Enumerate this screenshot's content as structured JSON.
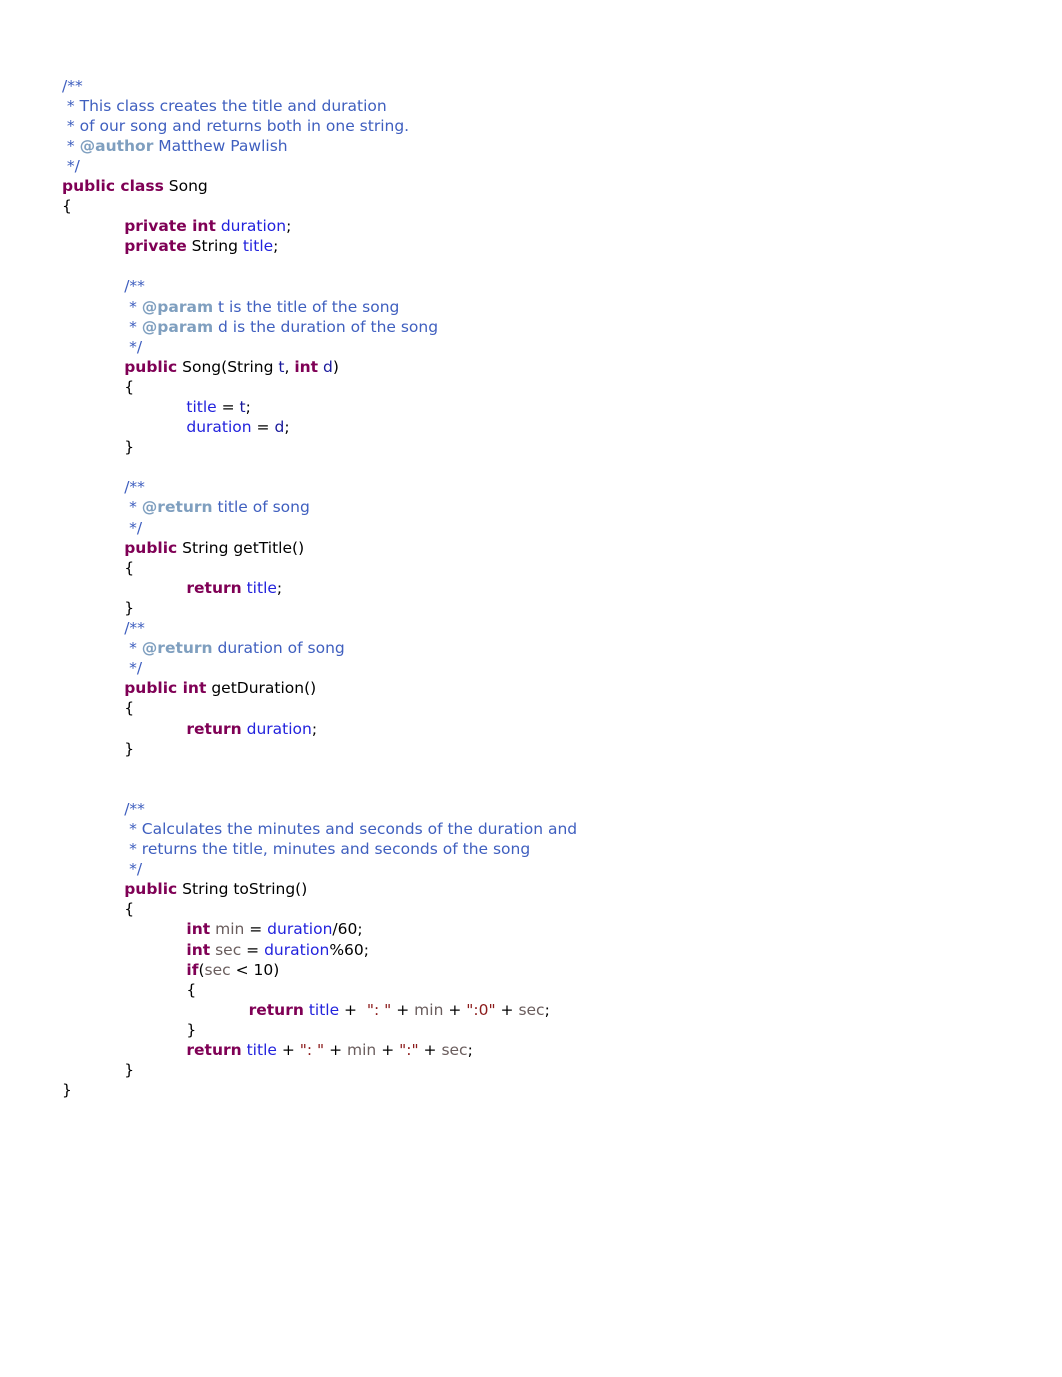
{
  "document": {
    "kind": "java-source-listing",
    "file_title": "Song.java",
    "class_name": "Song",
    "author": "Matthew Pawlish",
    "background_color": "#ffffff",
    "colors": {
      "comment": "#3f5fbf",
      "comment_tag": "#7f9fbf",
      "keyword": "#7f0055",
      "field": "#2222dd",
      "parameter": "#19199c",
      "local_variable": "#6a5d5d",
      "string_literal": "#8b1a1a",
      "plain": "#000000"
    }
  },
  "code": {
    "lines": [
      {
        "indent": 0,
        "tokens": [
          {
            "t": "/**",
            "c": "cmt"
          }
        ]
      },
      {
        "indent": 0,
        "tokens": [
          {
            "t": " * This class creates the title and duration",
            "c": "cmt"
          }
        ]
      },
      {
        "indent": 0,
        "tokens": [
          {
            "t": " * of our song and returns both in one string.",
            "c": "cmt"
          }
        ]
      },
      {
        "indent": 0,
        "tokens": [
          {
            "t": " * ",
            "c": "cmt"
          },
          {
            "t": "@author",
            "c": "cmt-tag"
          },
          {
            "t": " Matthew Pawlish",
            "c": "cmt"
          }
        ]
      },
      {
        "indent": 0,
        "tokens": [
          {
            "t": " */",
            "c": "cmt"
          }
        ]
      },
      {
        "indent": 0,
        "tokens": [
          {
            "t": "public class",
            "c": "kw"
          },
          {
            "t": " Song",
            "c": "pln"
          }
        ]
      },
      {
        "indent": 0,
        "tokens": [
          {
            "t": "{",
            "c": "pln"
          }
        ]
      },
      {
        "indent": 1,
        "tokens": [
          {
            "t": "private int",
            "c": "kw"
          },
          {
            "t": " ",
            "c": "pln"
          },
          {
            "t": "duration",
            "c": "fld"
          },
          {
            "t": ";",
            "c": "pln"
          }
        ]
      },
      {
        "indent": 1,
        "tokens": [
          {
            "t": "private",
            "c": "kw"
          },
          {
            "t": " String ",
            "c": "pln"
          },
          {
            "t": "title",
            "c": "fld"
          },
          {
            "t": ";",
            "c": "pln"
          }
        ]
      },
      {
        "indent": 0,
        "tokens": []
      },
      {
        "indent": 1,
        "tokens": [
          {
            "t": "/**",
            "c": "cmt"
          }
        ]
      },
      {
        "indent": 1,
        "tokens": [
          {
            "t": " * ",
            "c": "cmt"
          },
          {
            "t": "@param",
            "c": "cmt-tag"
          },
          {
            "t": " t is the title of the song",
            "c": "cmt"
          }
        ]
      },
      {
        "indent": 1,
        "tokens": [
          {
            "t": " * ",
            "c": "cmt"
          },
          {
            "t": "@param",
            "c": "cmt-tag"
          },
          {
            "t": " d is the duration of the song",
            "c": "cmt"
          }
        ]
      },
      {
        "indent": 1,
        "tokens": [
          {
            "t": " */",
            "c": "cmt"
          }
        ]
      },
      {
        "indent": 1,
        "tokens": [
          {
            "t": "public",
            "c": "kw"
          },
          {
            "t": " Song(String ",
            "c": "pln"
          },
          {
            "t": "t",
            "c": "prm"
          },
          {
            "t": ", ",
            "c": "pln"
          },
          {
            "t": "int",
            "c": "kw"
          },
          {
            "t": " ",
            "c": "pln"
          },
          {
            "t": "d",
            "c": "prm"
          },
          {
            "t": ")",
            "c": "pln"
          }
        ]
      },
      {
        "indent": 1,
        "tokens": [
          {
            "t": "{",
            "c": "pln"
          }
        ]
      },
      {
        "indent": 2,
        "tokens": [
          {
            "t": "title",
            "c": "fld"
          },
          {
            "t": " = ",
            "c": "pln"
          },
          {
            "t": "t",
            "c": "prm"
          },
          {
            "t": ";",
            "c": "pln"
          }
        ]
      },
      {
        "indent": 2,
        "tokens": [
          {
            "t": "duration",
            "c": "fld"
          },
          {
            "t": " = ",
            "c": "pln"
          },
          {
            "t": "d",
            "c": "prm"
          },
          {
            "t": ";",
            "c": "pln"
          }
        ]
      },
      {
        "indent": 1,
        "tokens": [
          {
            "t": "}",
            "c": "pln"
          }
        ]
      },
      {
        "indent": 0,
        "tokens": []
      },
      {
        "indent": 1,
        "tokens": [
          {
            "t": "/**",
            "c": "cmt"
          }
        ]
      },
      {
        "indent": 1,
        "tokens": [
          {
            "t": " * ",
            "c": "cmt"
          },
          {
            "t": "@return",
            "c": "cmt-tag"
          },
          {
            "t": " title of song",
            "c": "cmt"
          }
        ]
      },
      {
        "indent": 1,
        "tokens": [
          {
            "t": " */",
            "c": "cmt"
          }
        ]
      },
      {
        "indent": 1,
        "tokens": [
          {
            "t": "public",
            "c": "kw"
          },
          {
            "t": " String getTitle()",
            "c": "pln"
          }
        ]
      },
      {
        "indent": 1,
        "tokens": [
          {
            "t": "{",
            "c": "pln"
          }
        ]
      },
      {
        "indent": 2,
        "tokens": [
          {
            "t": "return",
            "c": "kw"
          },
          {
            "t": " ",
            "c": "pln"
          },
          {
            "t": "title",
            "c": "fld"
          },
          {
            "t": ";",
            "c": "pln"
          }
        ]
      },
      {
        "indent": 1,
        "tokens": [
          {
            "t": "}",
            "c": "pln"
          }
        ]
      },
      {
        "indent": 1,
        "tokens": [
          {
            "t": "/**",
            "c": "cmt"
          }
        ]
      },
      {
        "indent": 1,
        "tokens": [
          {
            "t": " * ",
            "c": "cmt"
          },
          {
            "t": "@return",
            "c": "cmt-tag"
          },
          {
            "t": " duration of song",
            "c": "cmt"
          }
        ]
      },
      {
        "indent": 1,
        "tokens": [
          {
            "t": " */",
            "c": "cmt"
          }
        ]
      },
      {
        "indent": 1,
        "tokens": [
          {
            "t": "public int",
            "c": "kw"
          },
          {
            "t": " getDuration()",
            "c": "pln"
          }
        ]
      },
      {
        "indent": 1,
        "tokens": [
          {
            "t": "{",
            "c": "pln"
          }
        ]
      },
      {
        "indent": 2,
        "tokens": [
          {
            "t": "return",
            "c": "kw"
          },
          {
            "t": " ",
            "c": "pln"
          },
          {
            "t": "duration",
            "c": "fld"
          },
          {
            "t": ";",
            "c": "pln"
          }
        ]
      },
      {
        "indent": 1,
        "tokens": [
          {
            "t": "}",
            "c": "pln"
          }
        ]
      },
      {
        "indent": 0,
        "tokens": []
      },
      {
        "indent": 0,
        "tokens": []
      },
      {
        "indent": 1,
        "tokens": [
          {
            "t": "/**",
            "c": "cmt"
          }
        ]
      },
      {
        "indent": 1,
        "tokens": [
          {
            "t": " * Calculates the minutes and seconds of the duration and",
            "c": "cmt"
          }
        ]
      },
      {
        "indent": 1,
        "tokens": [
          {
            "t": " * returns the title, minutes and seconds of the song",
            "c": "cmt"
          }
        ]
      },
      {
        "indent": 1,
        "tokens": [
          {
            "t": " */",
            "c": "cmt"
          }
        ]
      },
      {
        "indent": 1,
        "tokens": [
          {
            "t": "public",
            "c": "kw"
          },
          {
            "t": " String toString()",
            "c": "pln"
          }
        ]
      },
      {
        "indent": 1,
        "tokens": [
          {
            "t": "{",
            "c": "pln"
          }
        ]
      },
      {
        "indent": 2,
        "tokens": [
          {
            "t": "int",
            "c": "kw"
          },
          {
            "t": " ",
            "c": "pln"
          },
          {
            "t": "min",
            "c": "loc"
          },
          {
            "t": " = ",
            "c": "pln"
          },
          {
            "t": "duration",
            "c": "fld"
          },
          {
            "t": "/60;",
            "c": "pln"
          }
        ]
      },
      {
        "indent": 2,
        "tokens": [
          {
            "t": "int",
            "c": "kw"
          },
          {
            "t": " ",
            "c": "pln"
          },
          {
            "t": "sec",
            "c": "loc"
          },
          {
            "t": " = ",
            "c": "pln"
          },
          {
            "t": "duration",
            "c": "fld"
          },
          {
            "t": "%60;",
            "c": "pln"
          }
        ]
      },
      {
        "indent": 2,
        "tokens": [
          {
            "t": "if",
            "c": "kw"
          },
          {
            "t": "(",
            "c": "pln"
          },
          {
            "t": "sec",
            "c": "loc"
          },
          {
            "t": " < 10)",
            "c": "pln"
          }
        ]
      },
      {
        "indent": 2,
        "tokens": [
          {
            "t": "{",
            "c": "pln"
          }
        ]
      },
      {
        "indent": 3,
        "tokens": [
          {
            "t": "return",
            "c": "kw"
          },
          {
            "t": " ",
            "c": "pln"
          },
          {
            "t": "title",
            "c": "fld"
          },
          {
            "t": " +  ",
            "c": "pln"
          },
          {
            "t": "\": \"",
            "c": "str"
          },
          {
            "t": " + ",
            "c": "pln"
          },
          {
            "t": "min",
            "c": "loc"
          },
          {
            "t": " + ",
            "c": "pln"
          },
          {
            "t": "\":0\"",
            "c": "str"
          },
          {
            "t": " + ",
            "c": "pln"
          },
          {
            "t": "sec",
            "c": "loc"
          },
          {
            "t": ";",
            "c": "pln"
          }
        ]
      },
      {
        "indent": 2,
        "tokens": [
          {
            "t": "}",
            "c": "pln"
          }
        ]
      },
      {
        "indent": 2,
        "tokens": [
          {
            "t": "return",
            "c": "kw"
          },
          {
            "t": " ",
            "c": "pln"
          },
          {
            "t": "title",
            "c": "fld"
          },
          {
            "t": " + ",
            "c": "pln"
          },
          {
            "t": "\": \"",
            "c": "str"
          },
          {
            "t": " + ",
            "c": "pln"
          },
          {
            "t": "min",
            "c": "loc"
          },
          {
            "t": " + ",
            "c": "pln"
          },
          {
            "t": "\":\"",
            "c": "str"
          },
          {
            "t": " + ",
            "c": "pln"
          },
          {
            "t": "sec",
            "c": "loc"
          },
          {
            "t": ";",
            "c": "pln"
          }
        ]
      },
      {
        "indent": 1,
        "tokens": [
          {
            "t": "}",
            "c": "pln"
          }
        ]
      },
      {
        "indent": 0,
        "tokens": [
          {
            "t": "}",
            "c": "pln"
          }
        ]
      }
    ]
  }
}
